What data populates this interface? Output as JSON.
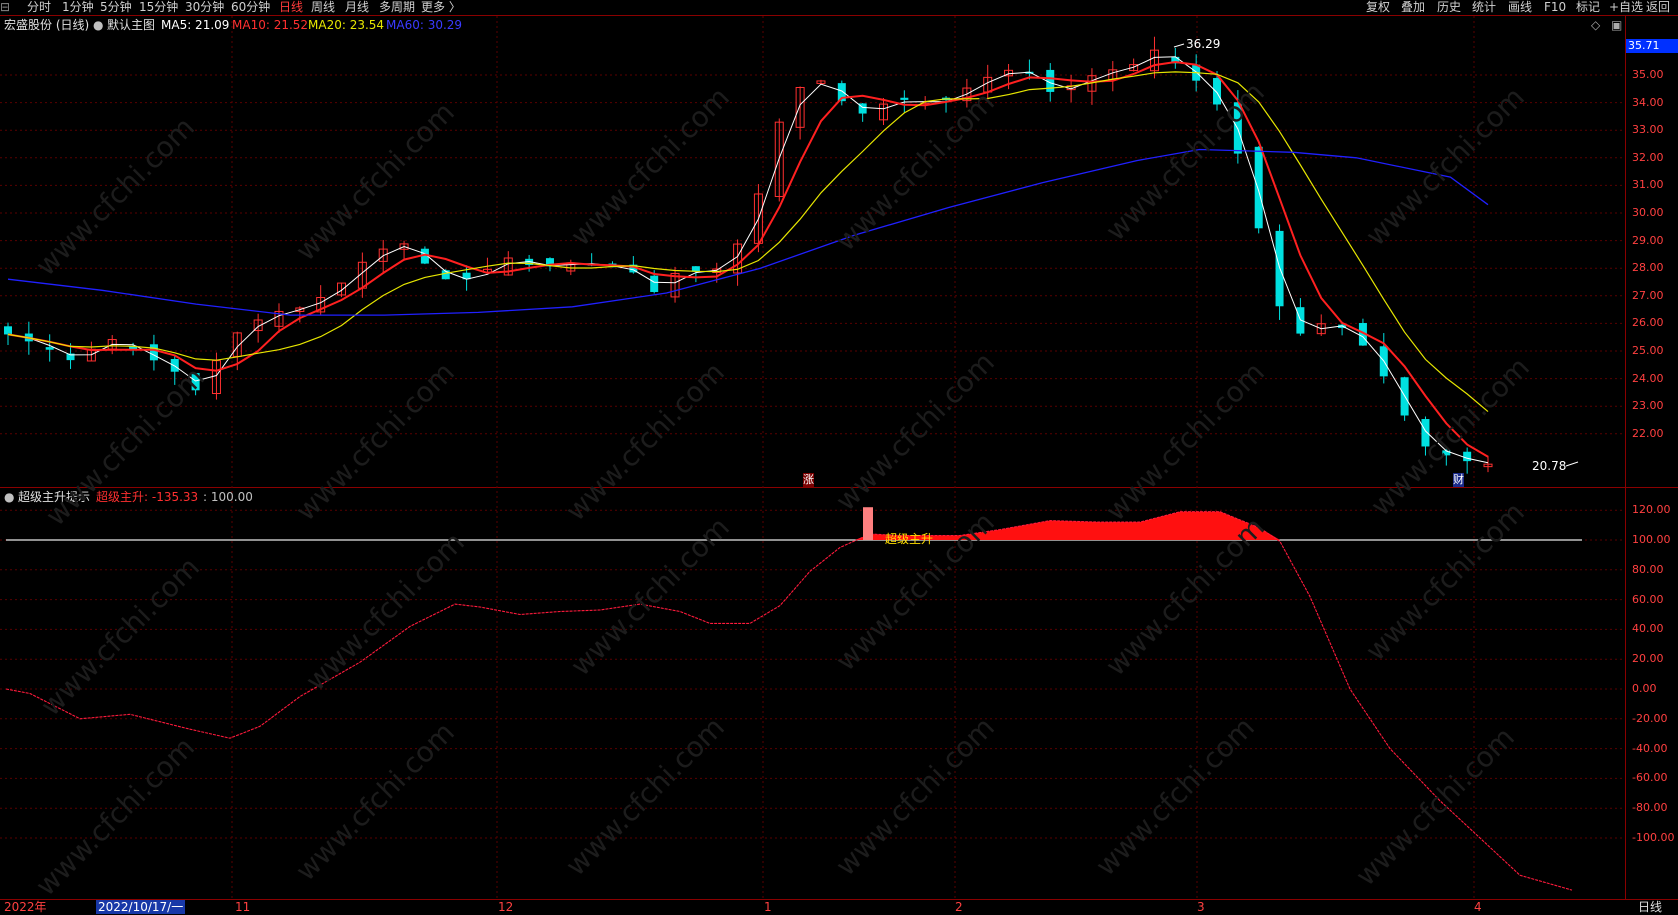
{
  "toolbar": {
    "left_items": [
      {
        "label": "分时"
      },
      {
        "label": "1分钟"
      },
      {
        "label": "5分钟"
      },
      {
        "label": "15分钟"
      },
      {
        "label": "30分钟"
      },
      {
        "label": "60分钟"
      },
      {
        "label": "日线",
        "active": true
      },
      {
        "label": "周线"
      },
      {
        "label": "月线"
      },
      {
        "label": "多周期"
      },
      {
        "label": "更多 〉"
      }
    ],
    "right_items": [
      {
        "label": "复权"
      },
      {
        "label": "叠加"
      },
      {
        "label": "历史"
      },
      {
        "label": "统计"
      },
      {
        "label": "画线"
      },
      {
        "label": "F10"
      },
      {
        "label": "标记"
      },
      {
        "label": "+自选"
      },
      {
        "label": "返回"
      }
    ]
  },
  "main_chart": {
    "stock_name": "宏盛股份 (日线)",
    "template": "默认主图",
    "ma5": "MA5: 21.09",
    "ma10": "MA10: 21.52",
    "ma20": "MA20: 23.54",
    "ma60": "MA60: 30.29",
    "current_price_tag": "35.71",
    "high_label": "36.29",
    "low_label": "20.78",
    "marker_zhang": "涨",
    "marker_cai": "财",
    "y_ticks": [
      "35.00",
      "34.00",
      "33.00",
      "32.00",
      "31.00",
      "30.00",
      "29.00",
      "28.00",
      "27.00",
      "26.00",
      "25.00",
      "24.00",
      "23.00",
      "22.00"
    ]
  },
  "indicator": {
    "name": "超级主升提示",
    "value_label": "超级主升: -135.33",
    "level_label": ": 100.00",
    "signal_text": "超级主升",
    "y_ticks": [
      "120.00",
      "100.00",
      "80.00",
      "60.00",
      "40.00",
      "20.00",
      "0.00",
      "-20.00",
      "-40.00",
      "-60.00",
      "-80.00",
      "-100.00"
    ]
  },
  "time_axis": {
    "labels": [
      "2022年",
      "2022/10/17/一",
      "11",
      "12",
      "1",
      "2",
      "3",
      "4"
    ],
    "period_button": "日线"
  },
  "watermark": "www.cfchi.com",
  "colors": {
    "up": "#ff3030",
    "down": "#00e0e0",
    "ma5": "#ffffff",
    "ma10": "#ff2020",
    "ma20": "#e6e600",
    "ma60": "#2020ff"
  },
  "chart_data": {
    "type": "candlestick",
    "ylim": [
      20.5,
      36.8
    ],
    "ma60": [
      [
        0,
        27.6
      ],
      [
        15,
        27.2
      ],
      [
        30,
        26.7
      ],
      [
        45,
        26.3
      ],
      [
        60,
        26.3
      ],
      [
        75,
        26.4
      ],
      [
        90,
        26.6
      ],
      [
        105,
        27.1
      ],
      [
        120,
        28.0
      ],
      [
        135,
        29.2
      ],
      [
        150,
        30.2
      ],
      [
        165,
        31.1
      ],
      [
        180,
        31.9
      ],
      [
        190,
        32.3
      ],
      [
        205,
        32.2
      ],
      [
        215,
        32.0
      ],
      [
        230,
        31.3
      ],
      [
        236,
        30.3
      ]
    ]
  }
}
